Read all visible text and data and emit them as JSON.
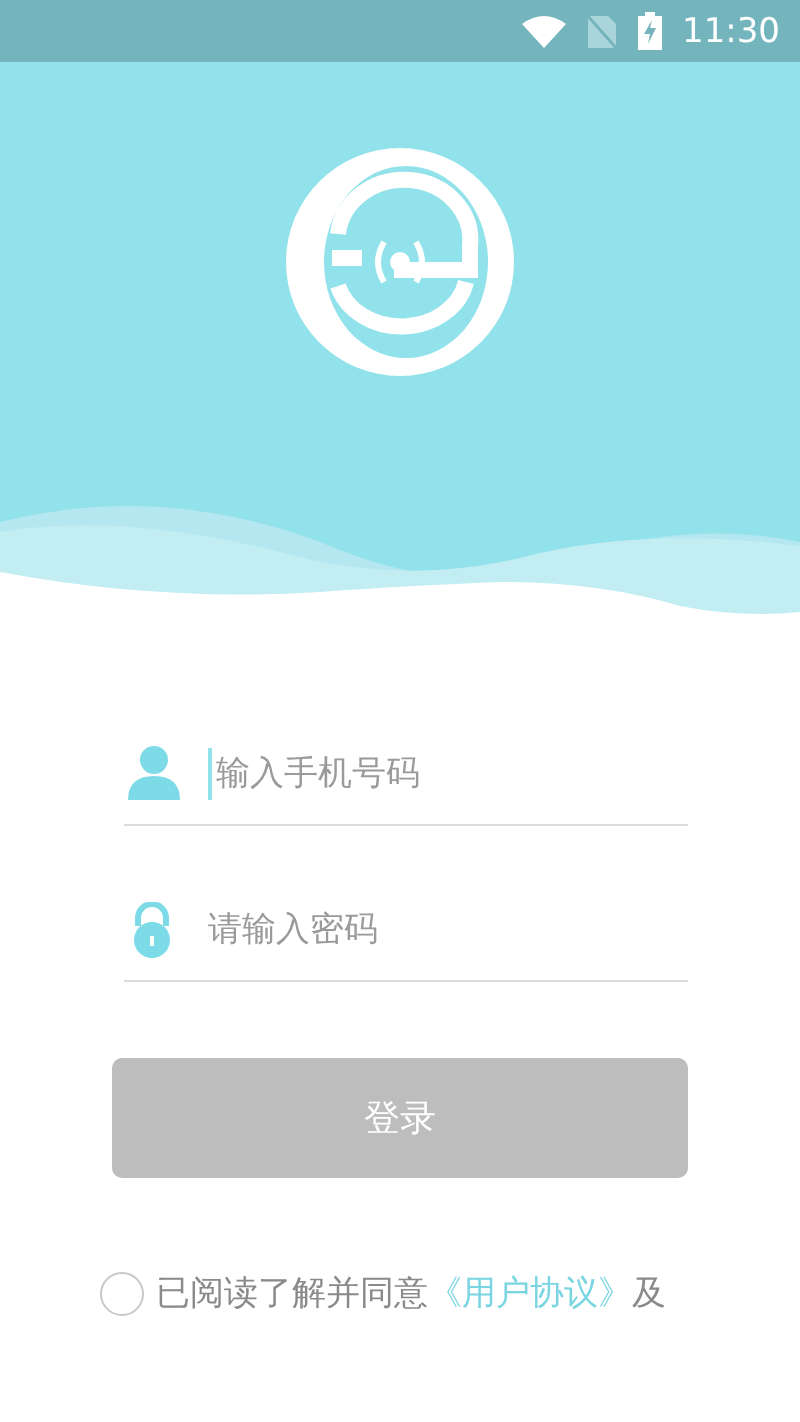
{
  "status_bar": {
    "time": "11:30"
  },
  "phone_field": {
    "placeholder": "输入手机号码",
    "focused": true
  },
  "password_field": {
    "placeholder": "请输入密码"
  },
  "login_button": {
    "label": "登录",
    "disabled": true
  },
  "agreement": {
    "checked": false,
    "prefix": "已阅读了解并同意",
    "link": "《用户协议》",
    "suffix": "及"
  }
}
